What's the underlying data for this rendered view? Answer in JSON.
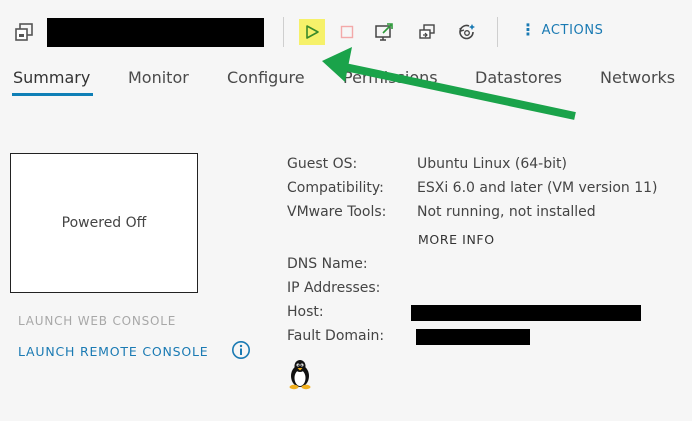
{
  "toolbar": {
    "vm_icon": "vm-icon",
    "vm_name_redacted": "",
    "buttons": [
      {
        "name": "power-on-icon",
        "highlighted": true
      },
      {
        "name": "power-off-icon"
      },
      {
        "name": "launch-console-icon"
      },
      {
        "name": "migrate-icon"
      },
      {
        "name": "snapshot-icon"
      }
    ],
    "actions_label": "ACTIONS",
    "highlight_color": "#f6f16a"
  },
  "tabs": [
    {
      "label": "Summary",
      "active": true
    },
    {
      "label": "Monitor"
    },
    {
      "label": "Configure"
    },
    {
      "label": "Permissions"
    },
    {
      "label": "Datastores"
    },
    {
      "label": "Networks"
    }
  ],
  "console": {
    "status": "Powered Off",
    "launch_web_console": "LAUNCH WEB CONSOLE",
    "launch_remote_console": "LAUNCH REMOTE CONSOLE",
    "info_icon": "info-icon"
  },
  "details": {
    "guest_os_label": "Guest OS:",
    "guest_os_value": "Ubuntu Linux (64-bit)",
    "compatibility_label": "Compatibility:",
    "compatibility_value": "ESXi 6.0 and later (VM version 11)",
    "vmware_tools_label": "VMware Tools:",
    "vmware_tools_value": "Not running, not installed",
    "more_info": "MORE INFO",
    "dns_name_label": "DNS Name:",
    "ip_addresses_label": "IP Addresses:",
    "host_label": "Host:",
    "fault_domain_label": "Fault Domain:",
    "os_icon": "linux-tux-icon"
  },
  "annotation": {
    "arrow_color": "#1aa34a"
  }
}
